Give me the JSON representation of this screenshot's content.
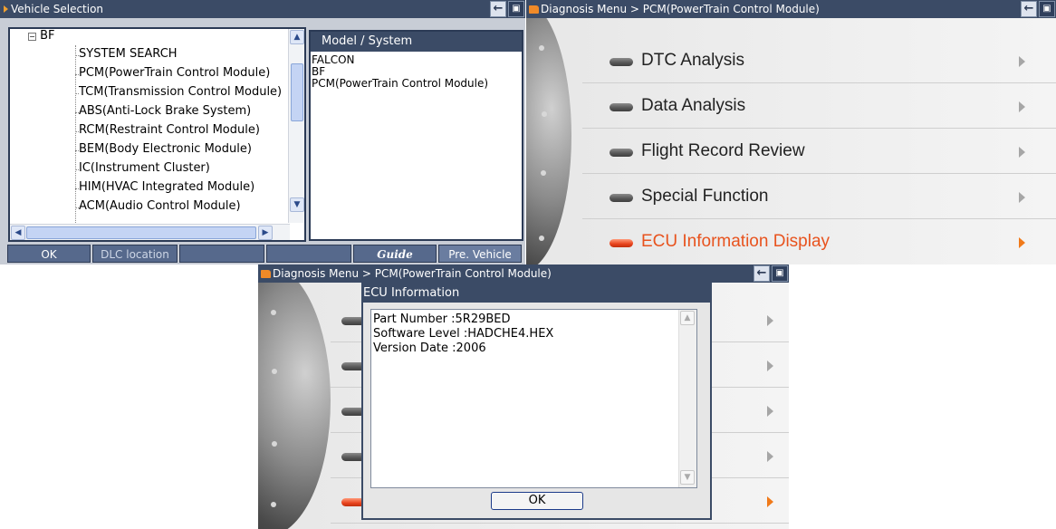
{
  "vehicle_selection": {
    "title": "Vehicle Selection",
    "tree": {
      "root_label": "BF",
      "items": [
        "SYSTEM SEARCH",
        "PCM(PowerTrain Control Module)",
        "TCM(Transmission Control Module)",
        "ABS(Anti-Lock Brake System)",
        "RCM(Restraint Control Module)",
        "BEM(Body Electronic Module)",
        "IC(Instrument Cluster)",
        "HIM(HVAC Integrated Module)",
        "ACM(Audio Control Module)"
      ]
    },
    "model_system": {
      "header": "Model / System",
      "lines": [
        "FALCON",
        "BF",
        "PCM(PowerTrain Control Module)"
      ]
    },
    "buttons": {
      "ok": "OK",
      "dlc": "DLC location",
      "blank1": "",
      "blank2": "",
      "guide": "Guide",
      "prev": "Pre. Vehicle"
    }
  },
  "diagnosis_menu": {
    "title": "Diagnosis Menu > PCM(PowerTrain Control Module)",
    "items": [
      {
        "label": "DTC Analysis",
        "active": false
      },
      {
        "label": "Data Analysis",
        "active": false
      },
      {
        "label": "Flight Record Review",
        "active": false
      },
      {
        "label": "Special Function",
        "active": false
      },
      {
        "label": "ECU Information Display",
        "active": true
      }
    ]
  },
  "diagnosis_menu_2": {
    "title": "Diagnosis Menu > PCM(PowerTrain Control Module)"
  },
  "ecu_dialog": {
    "title": "ECU Information",
    "lines": [
      "Part Number :5R29BED",
      "Software Level :HADCHE4.HEX",
      "Version Date :2006"
    ],
    "ok_label": "OK"
  },
  "colors": {
    "titlebar": "#3b4b66",
    "accent": "#e8531e"
  }
}
